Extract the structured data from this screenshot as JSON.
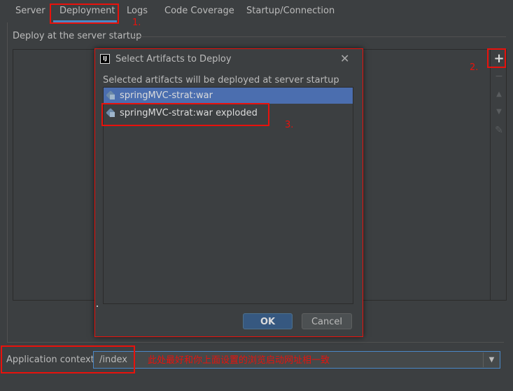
{
  "tabs": [
    {
      "label": "Server"
    },
    {
      "label": "Deployment"
    },
    {
      "label": "Logs"
    },
    {
      "label": "Code Coverage"
    },
    {
      "label": "Startup/Connection"
    }
  ],
  "active_tab": "Deployment",
  "section": {
    "title": "Deploy at the server startup"
  },
  "toolbar": {
    "add": "+",
    "remove": "−",
    "up": "▲",
    "down": "▼",
    "edit": "✎"
  },
  "dialog": {
    "title": "Select Artifacts to Deploy",
    "close": "✕",
    "subtitle": "Selected artifacts will be deployed at server startup",
    "items": [
      {
        "label": "springMVC-strat:war",
        "selected": true
      },
      {
        "label": "springMVC-strat:war exploded",
        "selected": false
      }
    ],
    "ok": "OK",
    "cancel": "Cancel",
    "icon_text": "IJ"
  },
  "app_context": {
    "label": "Application context:",
    "value": "/index"
  },
  "annotations": {
    "n1": "1.",
    "n2": "2.",
    "n3": "3.",
    "note": "此处最好和你上面设置的浏览启动网址相一致"
  },
  "colors": {
    "accent": "#4a88c7",
    "annotation": "#e8120c",
    "selection": "#4b6eaf",
    "background": "#3c3f41"
  }
}
